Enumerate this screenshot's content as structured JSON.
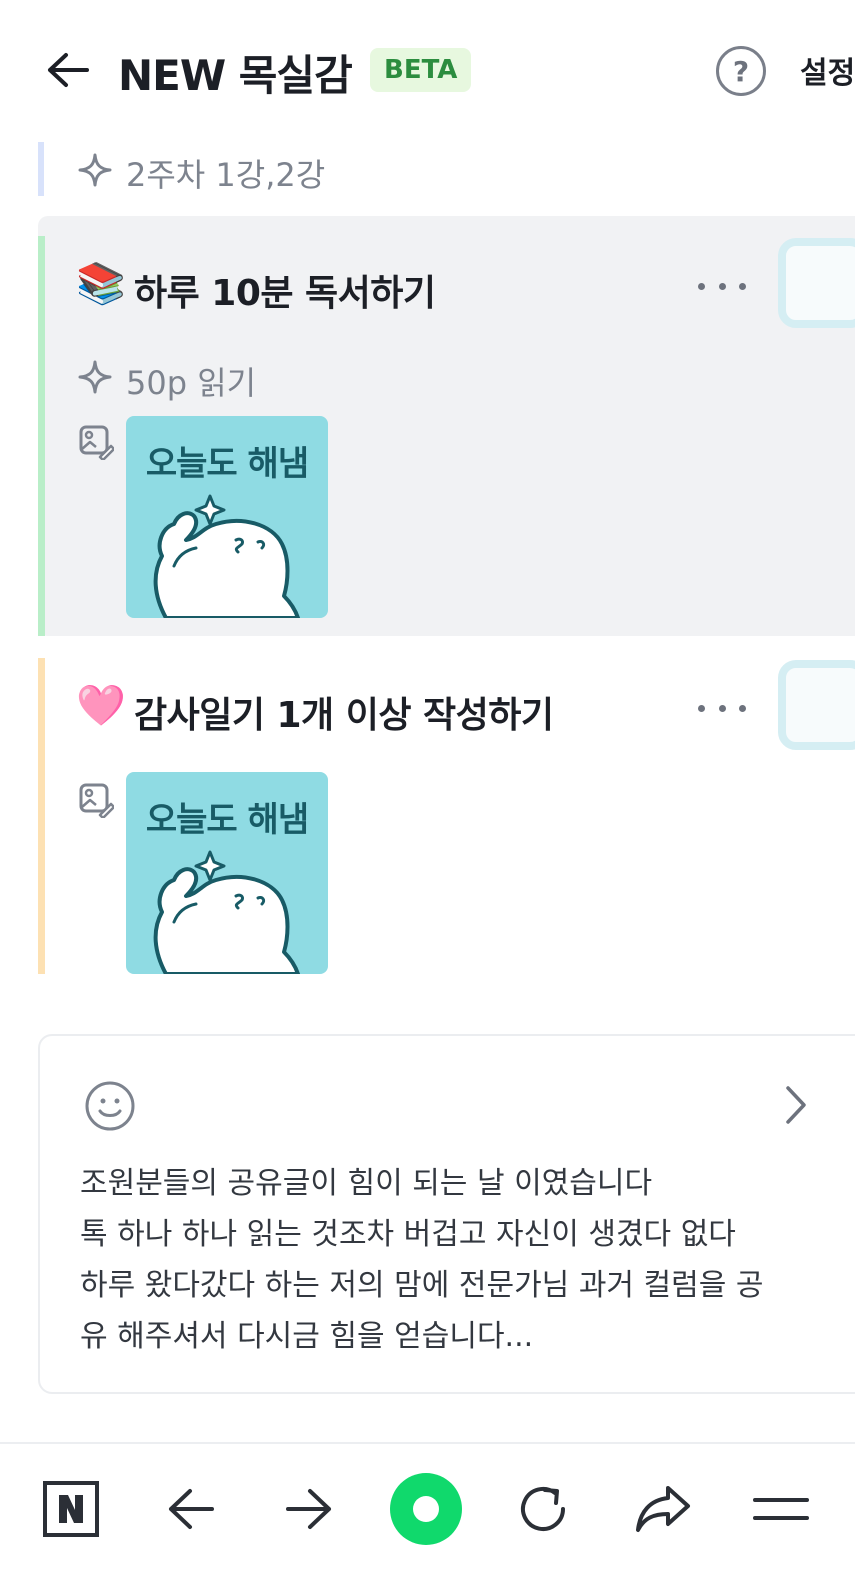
{
  "header": {
    "title": "NEW 목실감",
    "badge": "BETA",
    "help_label": "?",
    "settings_label": "설정"
  },
  "week": {
    "label": "2주차 1강,2강"
  },
  "tasks": [
    {
      "emoji": "📚",
      "title": "하루 10분 독서하기",
      "subtitle": "50p 읽기",
      "sticker_text": "오늘도 해냄",
      "accent_color": "#b9eec8"
    },
    {
      "emoji": "🩷",
      "title": "감사일기 1개 이상 작성하기",
      "subtitle": "",
      "sticker_text": "오늘도 해냄",
      "accent_color": "#fde1b3"
    }
  ],
  "comment": {
    "lines": [
      "조원분들의 공유글이 힘이 되는 날 이였습니다",
      "톡 하나 하나 읽는 것조차 버겁고 자신이 생겼다 없다",
      "하루 왔다갔다 하는 저의 맘에 전문가님 과거 컬럼을 공",
      "유 해주셔서 다시금 힘을 얻습니다..."
    ]
  },
  "toolbar": {
    "items": [
      "naver-home-icon",
      "back-arrow-icon",
      "forward-arrow-icon",
      "green-dot-icon",
      "refresh-icon",
      "share-icon",
      "menu-icon"
    ],
    "n_label": "N"
  },
  "colors": {
    "beta_bg": "#e7f8df",
    "beta_text": "#2c8d3f",
    "sticker_bg": "#8fdbe3",
    "green_button": "#10d96c"
  }
}
